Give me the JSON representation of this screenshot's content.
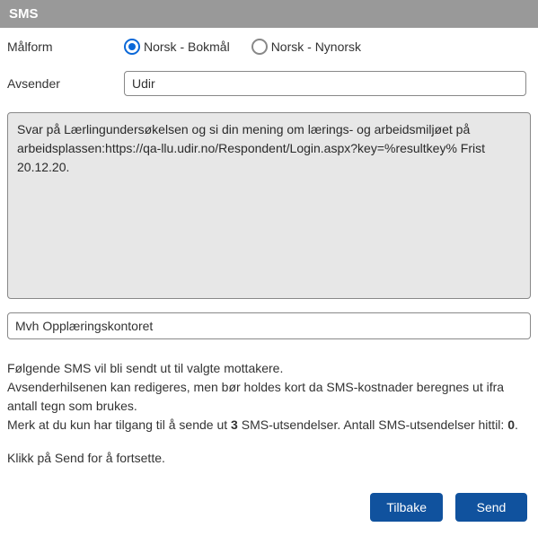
{
  "header": {
    "title": "SMS"
  },
  "form": {
    "languageLabel": "Målform",
    "bokmaal": "Norsk - Bokmål",
    "nynorsk": "Norsk - Nynorsk",
    "senderLabel": "Avsender",
    "senderValue": "Udir",
    "message": "Svar på Lærlingundersøkelsen og si din mening om lærings- og arbeidsmiljøet på arbeidsplassen:https://qa-llu.udir.no/Respondent/Login.aspx?key=%resultkey% Frist 20.12.20.",
    "signature": "Mvh Opplæringskontoret"
  },
  "info": {
    "line1": "Følgende SMS vil bli sendt ut til valgte mottakere.",
    "line2": "Avsenderhilsenen kan redigeres, men bør holdes kort da SMS-kostnader beregnes ut ifra antall tegn som brukes.",
    "line3_a": "Merk at du kun har tilgang til å sende ut ",
    "line3_b": "3",
    "line3_c": " SMS-utsendelser. Antall SMS-utsendelser hittil: ",
    "line3_d": "0",
    "line3_e": ".",
    "cta_a": "Klikk på ",
    "cta_b": "Send",
    "cta_c": " for å fortsette."
  },
  "buttons": {
    "back": "Tilbake",
    "send": "Send"
  }
}
